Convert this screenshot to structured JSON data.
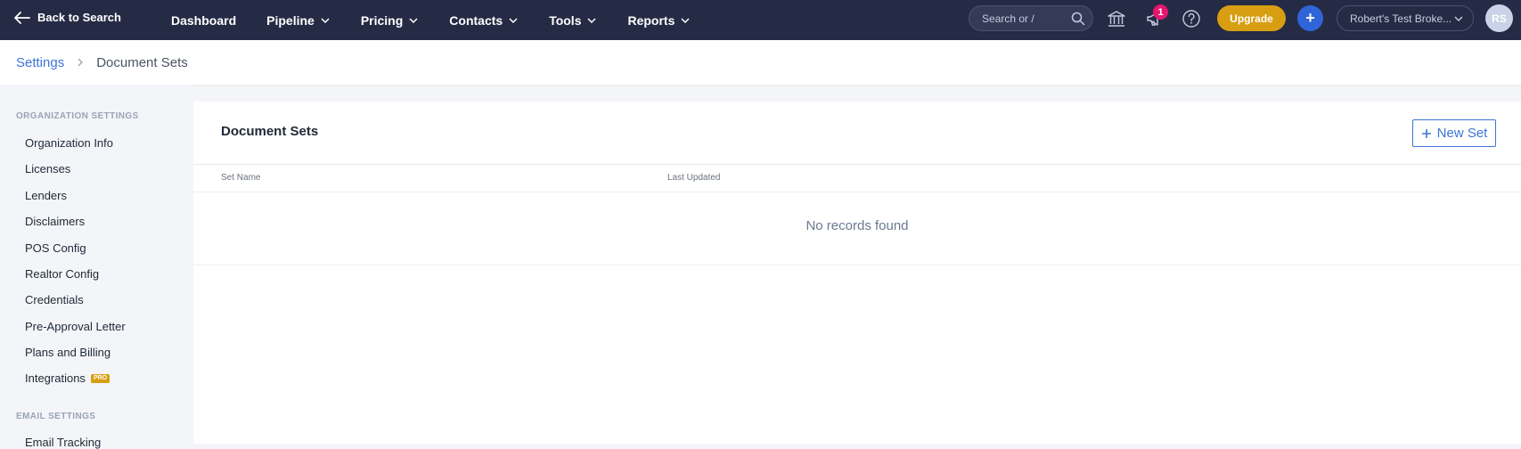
{
  "topbar": {
    "back_label": "Back to Search",
    "nav": [
      {
        "label": "Dashboard",
        "has_menu": false
      },
      {
        "label": "Pipeline",
        "has_menu": true
      },
      {
        "label": "Pricing",
        "has_menu": true
      },
      {
        "label": "Contacts",
        "has_menu": true
      },
      {
        "label": "Tools",
        "has_menu": true
      },
      {
        "label": "Reports",
        "has_menu": true
      }
    ],
    "search_placeholder": "Search or /",
    "notification_count": "1",
    "upgrade_label": "Upgrade",
    "plus_label": "+",
    "org_name": "Robert's Test Broke...",
    "avatar_initials": "RS",
    "icons": [
      "arrow-left-icon",
      "search-icon",
      "bank-icon",
      "megaphone-icon",
      "help-icon",
      "chevron-down-icon"
    ]
  },
  "breadcrumb": {
    "parent": "Settings",
    "current": "Document Sets"
  },
  "sidebar": {
    "org_heading": "ORGANIZATION SETTINGS",
    "org_items": [
      "Organization Info",
      "Licenses",
      "Lenders",
      "Disclaimers",
      "POS Config",
      "Realtor Config",
      "Credentials",
      "Pre-Approval Letter",
      "Plans and Billing",
      "Integrations"
    ],
    "pro_badge": "PRO",
    "email_heading": "EMAIL SETTINGS",
    "email_items": [
      "Email Tracking"
    ]
  },
  "main": {
    "title": "Document Sets",
    "new_button": "New Set",
    "columns": [
      "Set Name",
      "Last Updated"
    ],
    "empty_text": "No records found"
  },
  "colors": {
    "topbar_bg": "#262b45",
    "accent_blue": "#3e74d6",
    "upgrade_gold": "#d89e12",
    "badge_pink": "#e6166f"
  }
}
